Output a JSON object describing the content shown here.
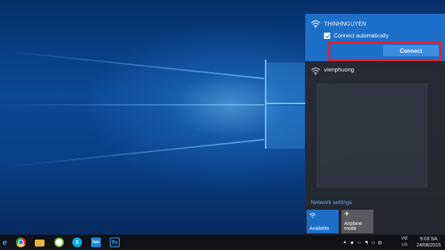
{
  "flyout": {
    "connected_network": {
      "name": "THINHNGUYEN",
      "connect_automatically_label": "Connect automatically",
      "connect_automatically_checked": true,
      "connect_button_label": "Connect"
    },
    "other_networks": [
      {
        "name": "vienphuong"
      }
    ],
    "network_settings_label": "Network settings",
    "tiles": [
      {
        "label": "Available",
        "icon": "wifi-icon",
        "active": true
      },
      {
        "label": "Airplane mode",
        "icon": "airplane-icon",
        "active": false
      }
    ]
  },
  "taskbar": {
    "apps": [
      {
        "icon": "edge-icon"
      },
      {
        "icon": "chrome-icon"
      },
      {
        "icon": "file-explorer-icon"
      },
      {
        "icon": "green-app-icon"
      },
      {
        "icon": "skype-icon"
      },
      {
        "icon": "zalo-icon",
        "text": "Zalo"
      },
      {
        "icon": "photoshop-icon",
        "text": "Ps"
      }
    ],
    "language": {
      "line1": "VIE",
      "line2": "US"
    },
    "clock": {
      "time": "9:03 SA",
      "date": "24/08/2015"
    }
  },
  "colors": {
    "accent": "#1e6fc8",
    "highlight": "#e5202e",
    "link": "#5aaef5"
  }
}
